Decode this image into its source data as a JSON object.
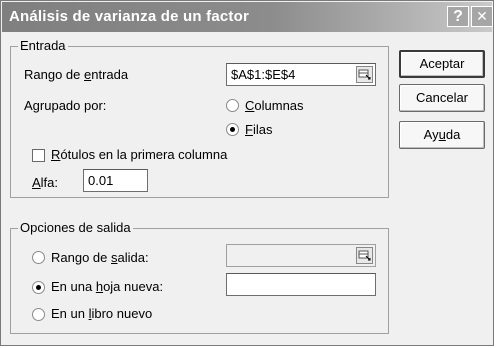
{
  "window": {
    "title": "Análisis de varianza de un factor",
    "help_glyph": "?",
    "close_glyph": "✕"
  },
  "input_group": {
    "label": "Entrada",
    "range_label_pre": "Rango de ",
    "range_label_u": "e",
    "range_label_post": "ntrada",
    "range_value": "$A$1:$E$4",
    "grouped_label": "Agrupado por:",
    "columns_u": "C",
    "columns_rest": "olumnas",
    "columns_selected": false,
    "rows_u": "F",
    "rows_rest": "ilas",
    "rows_selected": true,
    "labels_u": "R",
    "labels_rest": "ótulos en la primera columna",
    "labels_checked": false,
    "alpha_u": "A",
    "alpha_rest": "lfa:",
    "alpha_value": "0.01"
  },
  "output_group": {
    "label": "Opciones de salida",
    "out_range_pre": "Rango de ",
    "out_range_u": "s",
    "out_range_post": "alida:",
    "out_range_selected": false,
    "out_range_value": "",
    "new_sheet_pre": "En una ",
    "new_sheet_u": "h",
    "new_sheet_post": "oja nueva:",
    "new_sheet_selected": true,
    "new_sheet_value": "",
    "new_book_pre": "En un ",
    "new_book_u": "l",
    "new_book_post": "ibro nuevo",
    "new_book_selected": false
  },
  "buttons": {
    "ok": "Aceptar",
    "cancel": "Cancelar",
    "help_pre": "Ay",
    "help_u": "u",
    "help_post": "da"
  }
}
